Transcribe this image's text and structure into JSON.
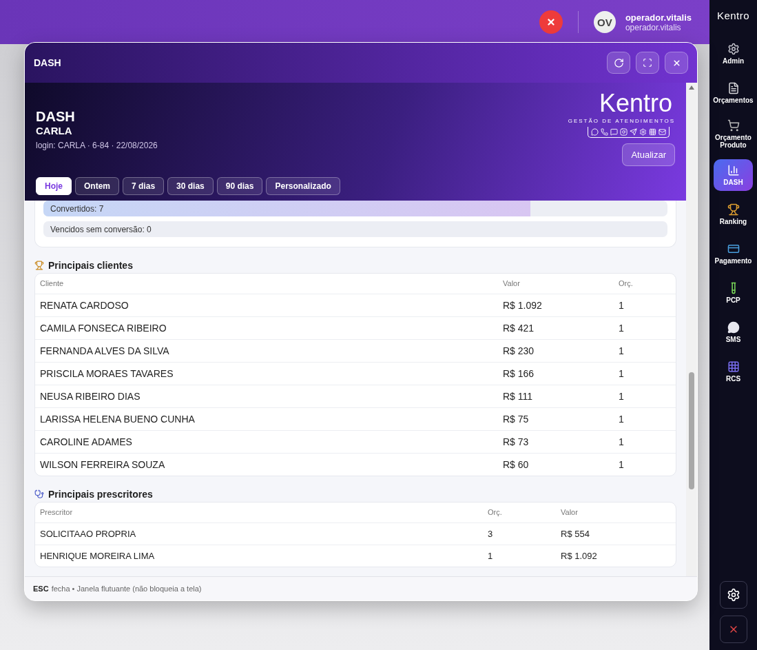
{
  "topbar": {
    "user_initials": "OV",
    "user_name": "operador.vitalis",
    "user_login": "operador.vitalis"
  },
  "sidebar": {
    "logo": "Kentro",
    "items": [
      {
        "label": "Admin",
        "selected": false
      },
      {
        "label": "Orçamentos",
        "selected": false
      },
      {
        "label": "Orçamento Produto",
        "selected": false
      },
      {
        "label": "DASH",
        "selected": true
      },
      {
        "label": "Ranking",
        "selected": false
      },
      {
        "label": "Pagamento",
        "selected": false
      },
      {
        "label": "PCP",
        "selected": false
      },
      {
        "label": "SMS",
        "selected": false
      },
      {
        "label": "RCS",
        "selected": false
      }
    ]
  },
  "window": {
    "title": "DASH",
    "footer_key": "ESC",
    "footer_text": "fecha • Janela flutuante (não bloqueia a tela)"
  },
  "hero": {
    "title": "DASH",
    "name": "CARLA",
    "meta": "login: CARLA · 6-84 · 22/08/2026",
    "logo": "Kentro",
    "logo_tagline": "GESTÃO DE ATENDIMENTOS",
    "refresh_label": "Atualizar"
  },
  "periods": [
    {
      "label": "Hoje",
      "selected": true
    },
    {
      "label": "Ontem",
      "selected": false
    },
    {
      "label": "7 dias",
      "selected": false
    },
    {
      "label": "30 dias",
      "selected": false
    },
    {
      "label": "90 dias",
      "selected": false
    },
    {
      "label": "Personalizado",
      "selected": false
    }
  ],
  "funnel": [
    {
      "label": "Convertidos: 7",
      "level": 0.78
    },
    {
      "label": "Vencidos sem conversão: 0"
    }
  ],
  "clients": {
    "title": "Principais clientes",
    "columns": [
      "Cliente",
      "Valor",
      "Orç."
    ],
    "rows": [
      [
        "RENATA CARDOSO",
        "R$ 1.092",
        "1"
      ],
      [
        "CAMILA FONSECA RIBEIRO",
        "R$ 421",
        "1"
      ],
      [
        "FERNANDA ALVES DA SILVA",
        "R$ 230",
        "1"
      ],
      [
        "PRISCILA MORAES TAVARES",
        "R$ 166",
        "1"
      ],
      [
        "NEUSA RIBEIRO DIAS",
        "R$ 111",
        "1"
      ],
      [
        "LARISSA HELENA BUENO CUNHA",
        "R$ 75",
        "1"
      ],
      [
        "CAROLINE ADAMES",
        "R$ 73",
        "1"
      ],
      [
        "WILSON FERREIRA SOUZA",
        "R$ 60",
        "1"
      ]
    ]
  },
  "prescribers": {
    "title": "Principais prescritores",
    "columns": [
      "Prescritor",
      "Orç.",
      "Valor"
    ],
    "rows": [
      [
        "SOLICITAAO PROPRIA",
        "3",
        "R$ 554"
      ],
      [
        "HENRIQUE MOREIRA LIMA",
        "1",
        "R$ 1.092"
      ]
    ]
  }
}
